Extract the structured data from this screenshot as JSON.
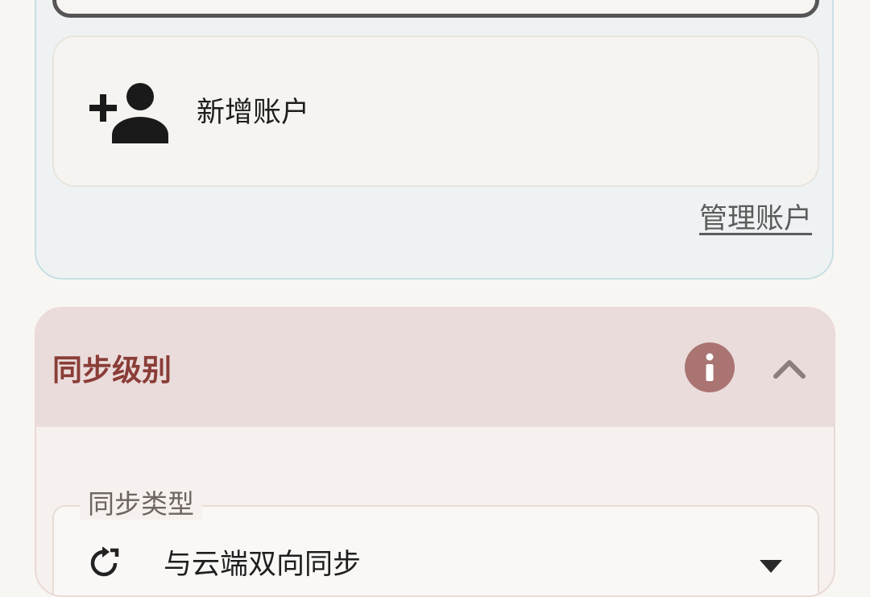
{
  "accounts": {
    "add_account_label": "新增账户",
    "manage_accounts_label": "管理账户"
  },
  "sync_level": {
    "title": "同步级别",
    "sync_type": {
      "label": "同步类型",
      "value": "与云端双向同步"
    }
  },
  "icons": {
    "add_account": "person-add-icon",
    "info": "info-icon",
    "collapse": "chevron-up-icon",
    "sync_type": "sync-icon",
    "dropdown": "triangle-down-icon"
  },
  "colors": {
    "accounts_card_bg": "#eef2f3",
    "sync_header_bg": "#ebdcdc",
    "sync_title": "#8a3d37",
    "info_button": "#a97472"
  }
}
